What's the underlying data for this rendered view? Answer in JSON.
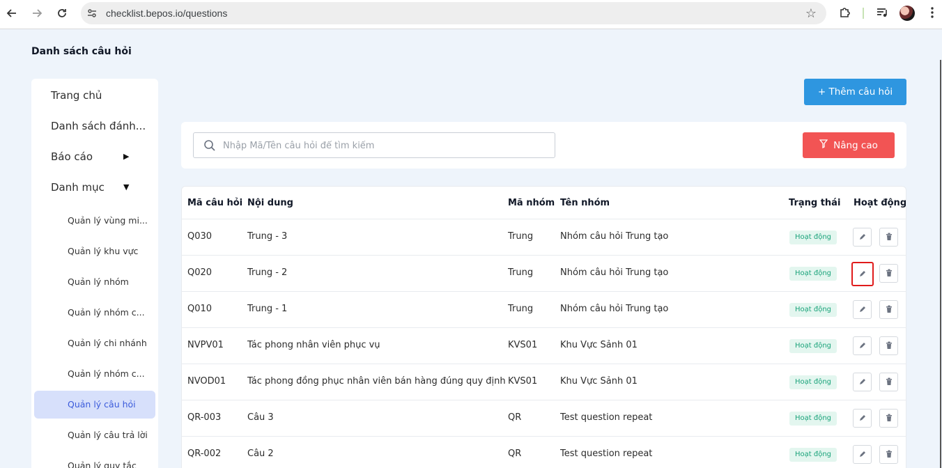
{
  "browser": {
    "url": "checklist.bepos.io/questions",
    "icons": [
      "back-arrow-icon",
      "forward-arrow-icon",
      "reload-icon",
      "site-settings-icon",
      "bookmark-star-icon",
      "extensions-icon",
      "media-queue-icon",
      "profile-avatar",
      "kebab-menu-icon"
    ]
  },
  "page": {
    "title": "Danh sách câu hỏi"
  },
  "sidebar": {
    "items": [
      {
        "label": "Trang chủ"
      },
      {
        "label": "Danh sách đánh..."
      },
      {
        "label": "Báo cáo",
        "caret": "▶"
      },
      {
        "label": "Danh mục",
        "caret": "▼"
      }
    ],
    "sub_items": [
      {
        "label": "Quản lý vùng mi..."
      },
      {
        "label": "Quản lý khu vực"
      },
      {
        "label": "Quản lý nhóm"
      },
      {
        "label": "Quản lý nhóm c..."
      },
      {
        "label": "Quản lý chi nhánh"
      },
      {
        "label": "Quản lý nhóm c..."
      },
      {
        "label": "Quản lý câu hỏi",
        "active": true
      },
      {
        "label": "Quản lý câu trả lời"
      },
      {
        "label": "Quản lý quy tắc"
      }
    ]
  },
  "toolbar": {
    "add_label": "+ Thêm câu hỏi"
  },
  "search": {
    "placeholder": "Nhập Mã/Tên câu hỏi để tìm kiếm",
    "value": "",
    "advanced_label": "Nâng cao"
  },
  "table": {
    "headers": [
      "Mã câu hỏi",
      "Nội dung",
      "Mã nhóm",
      "Tên nhóm",
      "Trạng thái",
      "Hoạt động"
    ],
    "rows": [
      {
        "code": "Q030",
        "content": "Trung - 3",
        "group_code": "Trung",
        "group_name": "Nhóm câu hỏi Trung tạo",
        "status": "Hoạt động"
      },
      {
        "code": "Q020",
        "content": "Trung - 2",
        "group_code": "Trung",
        "group_name": "Nhóm câu hỏi Trung tạo",
        "status": "Hoạt động",
        "edit_highlighted": true
      },
      {
        "code": "Q010",
        "content": "Trung - 1",
        "group_code": "Trung",
        "group_name": "Nhóm câu hỏi Trung tạo",
        "status": "Hoạt động"
      },
      {
        "code": "NVPV01",
        "content": "Tác phong nhân viên phục vụ",
        "group_code": "KVS01",
        "group_name": "Khu Vực Sảnh 01",
        "status": "Hoạt động"
      },
      {
        "code": "NVOD01",
        "content": "Tác phong đồng phục nhân viên bán hàng đúng quy định",
        "group_code": "KVS01",
        "group_name": "Khu Vực Sảnh 01",
        "status": "Hoạt động"
      },
      {
        "code": "QR-003",
        "content": "Câu 3",
        "group_code": "QR",
        "group_name": "Test question repeat",
        "status": "Hoạt động"
      },
      {
        "code": "QR-002",
        "content": "Câu 2",
        "group_code": "QR",
        "group_name": "Test question repeat",
        "status": "Hoạt động"
      }
    ]
  },
  "colors": {
    "primary_blue": "#2e96e0",
    "danger_red": "#f25454",
    "status_green": "#1aa37a",
    "active_nav_bg": "#d7e0fb",
    "highlight_border": "#e01b1b"
  }
}
